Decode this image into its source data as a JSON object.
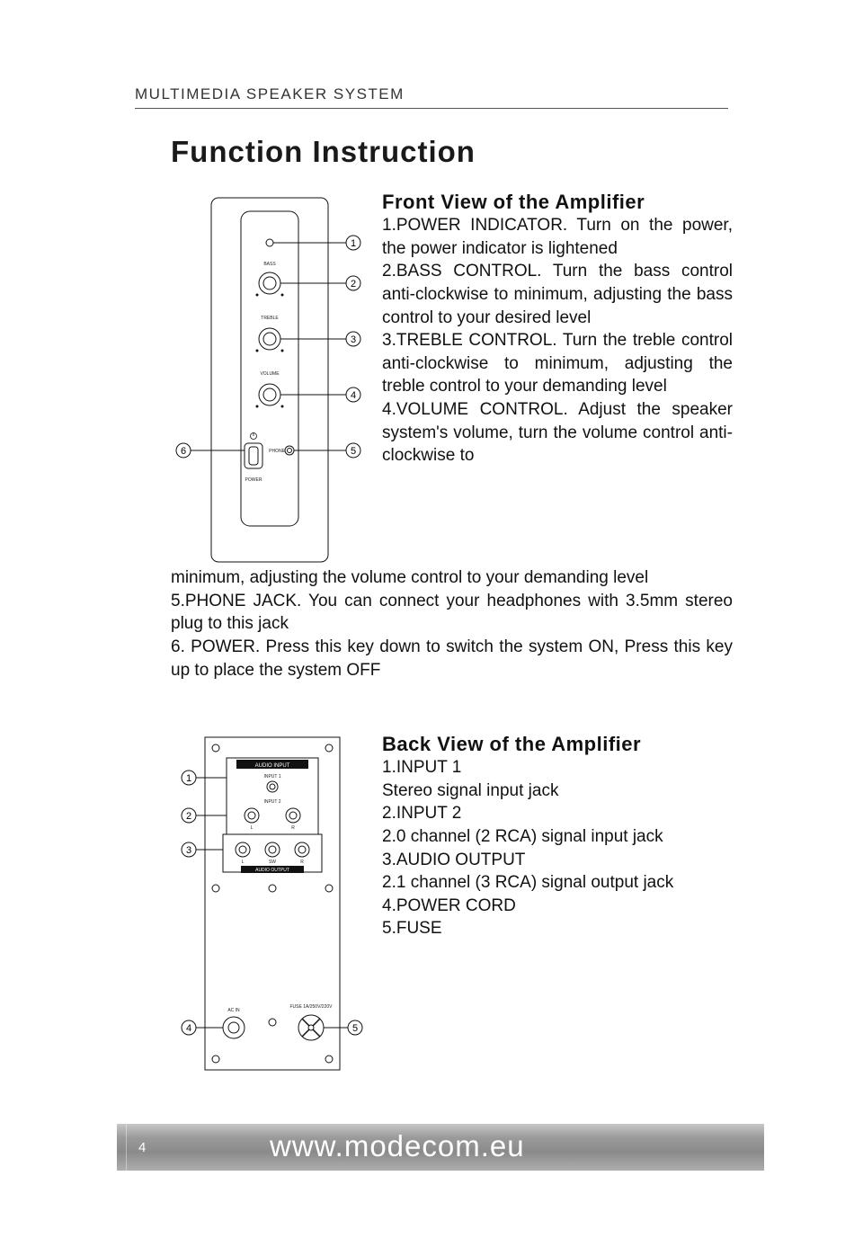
{
  "header": "MULTIMEDIA SPEAKER SYSTEM",
  "title": "Function Instruction",
  "front": {
    "heading": "Front View of the Amplifier",
    "p1": "1.POWER INDICATOR. Turn on the power, the power indicator is lightened",
    "p2": "2.BASS CONTROL. Turn the bass control anti-clockwise to minimum, adjusting the bass control to your desired level",
    "p3": "3.TREBLE CONTROL. Turn the treble control anti-clockwise to minimum, adjusting the treble control to your demanding level",
    "p4a": "4.VOLUME CONTROL. Adjust the speaker system's volume, turn the volume control anti-clockwise to",
    "p4b": "minimum, adjusting the volume control to your demanding level",
    "p5": "5.PHONE JACK. You can connect your headphones with 3.5mm stereo plug to this jack",
    "p6": "6. POWER. Press this key down to switch the system ON, Press this key up to place the system OFF",
    "diagram": {
      "c1": "1",
      "c2": "2",
      "c3": "3",
      "c4": "4",
      "c5": "5",
      "c6": "6",
      "lbl_bass": "BASS",
      "lbl_treble": "TREBLE",
      "lbl_volume": "VOLUME",
      "lbl_phone": "PHONE",
      "lbl_power": "POWER"
    }
  },
  "back": {
    "heading": "Back View of the Amplifier",
    "p1": "1.INPUT 1",
    "p2": "Stereo signal input jack",
    "p3": "2.INPUT 2",
    "p4": "2.0 channel (2 RCA) signal input jack",
    "p5": "3.AUDIO OUTPUT",
    "p6": "2.1 channel (3 RCA) signal output jack",
    "p7": "4.POWER CORD",
    "p8": "5.FUSE",
    "diagram": {
      "c1": "1",
      "c2": "2",
      "c3": "3",
      "c4": "4",
      "c5": "5",
      "lbl_audioin": "AUDIO INPUT",
      "lbl_in1": "INPUT 1",
      "lbl_in2": "INPUT 2",
      "lbl_audioout": "AUDIO OUTPUT",
      "lbl_l": "L",
      "lbl_r": "R",
      "lbl_l2": "L",
      "lbl_r2": "R",
      "lbl_sw": "SW",
      "lbl_ac": "AC IN",
      "lbl_fuse": "FUSE\n1A/250V/220V"
    }
  },
  "footer": {
    "page": "4",
    "url": "www.modecom.eu"
  }
}
